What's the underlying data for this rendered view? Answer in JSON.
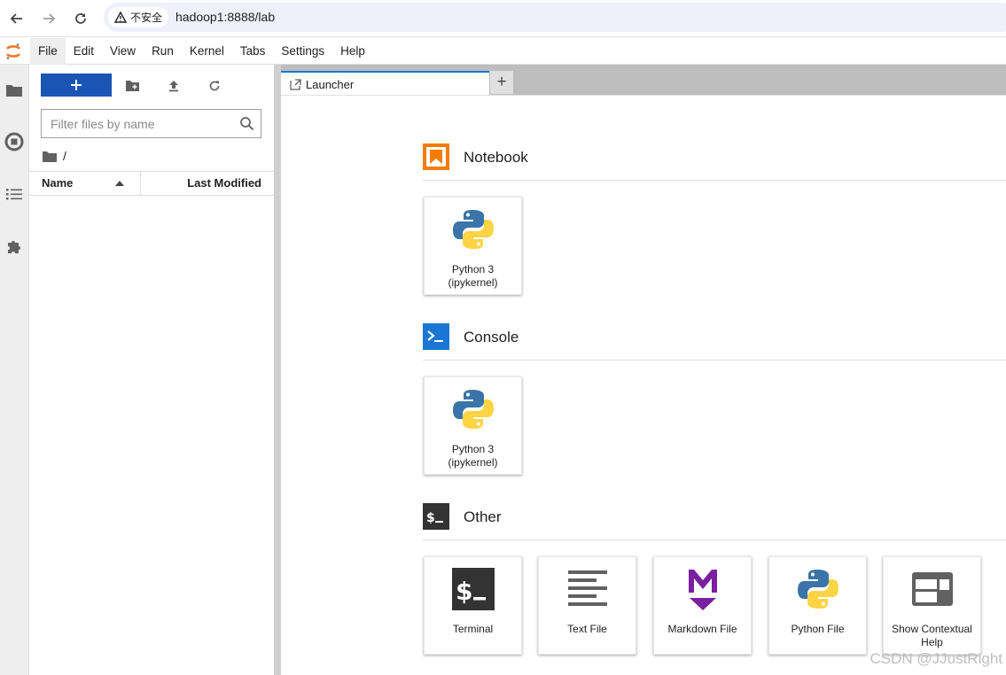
{
  "browser": {
    "security_label": "不安全",
    "url": "hadoop1:8888/lab"
  },
  "menu": {
    "items": [
      "File",
      "Edit",
      "View",
      "Run",
      "Kernel",
      "Tabs",
      "Settings",
      "Help"
    ],
    "active": "File"
  },
  "file_browser": {
    "filter_placeholder": "Filter files by name",
    "breadcrumb": "/",
    "col_name": "Name",
    "col_modified": "Last Modified"
  },
  "tabs": {
    "launcher_label": "Launcher",
    "add_label": "+"
  },
  "launcher": {
    "notebook": {
      "title": "Notebook",
      "cards": [
        {
          "label": "Python 3 (ipykernel)",
          "icon": "python-icon"
        }
      ]
    },
    "console": {
      "title": "Console",
      "cards": [
        {
          "label": "Python 3 (ipykernel)",
          "icon": "python-icon"
        }
      ]
    },
    "other": {
      "title": "Other",
      "cards": [
        {
          "label": "Terminal",
          "icon": "terminal-icon"
        },
        {
          "label": "Text File",
          "icon": "text-file-icon"
        },
        {
          "label": "Markdown File",
          "icon": "markdown-icon"
        },
        {
          "label": "Python File",
          "icon": "python-icon"
        },
        {
          "label": "Show Contextual Help",
          "icon": "contextual-help-icon"
        }
      ]
    }
  },
  "watermark": "CSDN @JJustRight",
  "colors": {
    "accent_blue": "#1a55b4",
    "notebook_orange": "#f57c00",
    "console_blue": "#1976d2",
    "other_dark": "#333333",
    "markdown_purple": "#7b1fa2"
  }
}
